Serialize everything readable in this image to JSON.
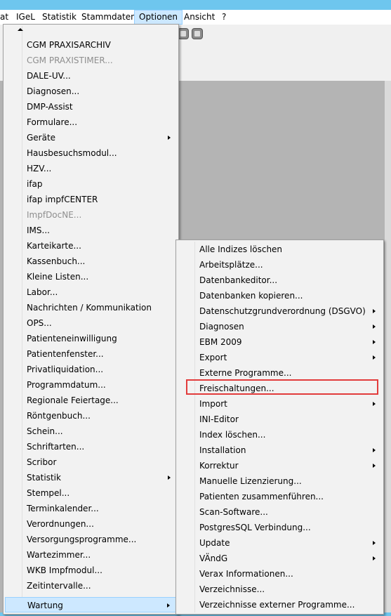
{
  "menubar": {
    "items": [
      {
        "label": "at"
      },
      {
        "label": "IGeL"
      },
      {
        "label": "Statistik"
      },
      {
        "label": "Stammdaten"
      },
      {
        "label": "Optionen"
      },
      {
        "label": "Ansicht"
      },
      {
        "label": "?"
      }
    ],
    "active": "Optionen"
  },
  "optionen_menu": {
    "items": [
      {
        "label": "CGM PRAXISARCHIV",
        "enabled": true
      },
      {
        "label": "CGM PRAXISTIMER...",
        "enabled": false
      },
      {
        "label": "DALE-UV...",
        "enabled": true
      },
      {
        "label": "Diagnosen...",
        "enabled": true
      },
      {
        "label": "DMP-Assist",
        "enabled": true
      },
      {
        "label": "Formulare...",
        "enabled": true
      },
      {
        "label": "Geräte",
        "enabled": true,
        "submenu": true
      },
      {
        "label": "Hausbesuchsmodul...",
        "enabled": true
      },
      {
        "label": "HZV...",
        "enabled": true
      },
      {
        "label": "ifap",
        "enabled": true
      },
      {
        "label": "ifap impfCENTER",
        "enabled": true
      },
      {
        "label": "ImpfDocNE...",
        "enabled": false
      },
      {
        "label": "IMS...",
        "enabled": true
      },
      {
        "label": "Karteikarte...",
        "enabled": true
      },
      {
        "label": "Kassenbuch...",
        "enabled": true
      },
      {
        "label": "Kleine Listen...",
        "enabled": true
      },
      {
        "label": "Labor...",
        "enabled": true
      },
      {
        "label": "Nachrichten / Kommunikation",
        "enabled": true
      },
      {
        "label": "OPS...",
        "enabled": true
      },
      {
        "label": "Patienteneinwilligung",
        "enabled": true
      },
      {
        "label": "Patientenfenster...",
        "enabled": true
      },
      {
        "label": "Privatliquidation...",
        "enabled": true
      },
      {
        "label": "Programmdatum...",
        "enabled": true
      },
      {
        "label": "Regionale Feiertage...",
        "enabled": true
      },
      {
        "label": "Röntgenbuch...",
        "enabled": true
      },
      {
        "label": "Schein...",
        "enabled": true
      },
      {
        "label": "Schriftarten...",
        "enabled": true
      },
      {
        "label": "Scribor",
        "enabled": true
      },
      {
        "label": "Statistik",
        "enabled": true,
        "submenu": true
      },
      {
        "label": "Stempel...",
        "enabled": true
      },
      {
        "label": "Terminkalender...",
        "enabled": true
      },
      {
        "label": "Verordnungen...",
        "enabled": true
      },
      {
        "label": "Versorgungsprogramme...",
        "enabled": true
      },
      {
        "label": "Wartezimmer...",
        "enabled": true
      },
      {
        "label": "WKB Impfmodul...",
        "enabled": true
      },
      {
        "label": "Zeitintervalle...",
        "enabled": true
      },
      {
        "label": "Wartung",
        "enabled": true,
        "submenu": true,
        "selected": true
      }
    ]
  },
  "wartung_submenu": {
    "items": [
      {
        "label": "Alle Indizes löschen"
      },
      {
        "label": "Arbeitsplätze..."
      },
      {
        "label": "Datenbankeditor..."
      },
      {
        "label": "Datenbanken kopieren..."
      },
      {
        "label": "Datenschutzgrundverordnung (DSGVO)",
        "submenu": true
      },
      {
        "label": "Diagnosen",
        "submenu": true
      },
      {
        "label": "EBM 2009",
        "submenu": true
      },
      {
        "label": "Export",
        "submenu": true
      },
      {
        "label": "Externe Programme..."
      },
      {
        "label": "Freischaltungen...",
        "highlighted": true
      },
      {
        "label": "Import",
        "submenu": true
      },
      {
        "label": "INI-Editor"
      },
      {
        "label": "Index löschen..."
      },
      {
        "label": "Installation",
        "submenu": true
      },
      {
        "label": "Korrektur",
        "submenu": true
      },
      {
        "label": "Manuelle Lizenzierung..."
      },
      {
        "label": "Patienten zusammenführen..."
      },
      {
        "label": "Scan-Software..."
      },
      {
        "label": "PostgresSQL Verbindung..."
      },
      {
        "label": "Update",
        "submenu": true
      },
      {
        "label": "VÄndG",
        "submenu": true
      },
      {
        "label": "Verax Informationen..."
      },
      {
        "label": "Verzeichnisse..."
      },
      {
        "label": "Verzeichnisse externer Programme..."
      }
    ]
  },
  "colors": {
    "titlebar": "#6ec6ee",
    "selection": "#cde8ff",
    "highlight_border": "#e23c3c",
    "workspace": "#b4b4b4"
  }
}
